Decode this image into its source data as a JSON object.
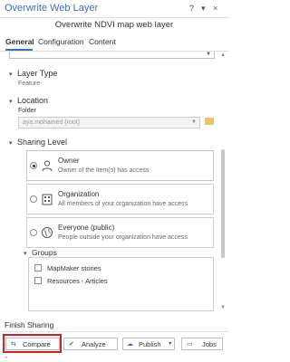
{
  "window": {
    "title": "Overwrite Web Layer",
    "controls": [
      "?",
      "▾",
      "×"
    ],
    "subtitle": "Overwrite NDVI map web layer"
  },
  "tabs": [
    {
      "label": "General",
      "active": true
    },
    {
      "label": "Configuration",
      "active": false
    },
    {
      "label": "Content",
      "active": false
    }
  ],
  "layer_type": {
    "heading": "Layer Type",
    "value": "Feature"
  },
  "location": {
    "heading": "Location",
    "folder_label": "Folder",
    "folder_value": "aya.mohamed (root)"
  },
  "sharing": {
    "heading": "Sharing Level",
    "options": [
      {
        "name": "Owner",
        "desc": "Owner of the item(s) has access",
        "selected": true,
        "icon": "person-icon"
      },
      {
        "name": "Organization",
        "desc": "All members of your organization have access",
        "selected": false,
        "icon": "building-icon"
      },
      {
        "name": "Everyone (public)",
        "desc": "People outside your organization have access",
        "selected": false,
        "icon": "globe-icon"
      }
    ]
  },
  "groups": {
    "heading": "Groups",
    "items": [
      "MapMaker stories",
      "Resources - Articles"
    ]
  },
  "footer": {
    "heading": "Finish Sharing",
    "buttons": {
      "compare": "Compare",
      "analyze": "Analyze",
      "publish": "Publish",
      "jobs": "Jobs"
    }
  },
  "colors": {
    "accent": "#3a6fb5",
    "highlight": "#d0202a",
    "analyze_check": "#2e8b3d"
  }
}
